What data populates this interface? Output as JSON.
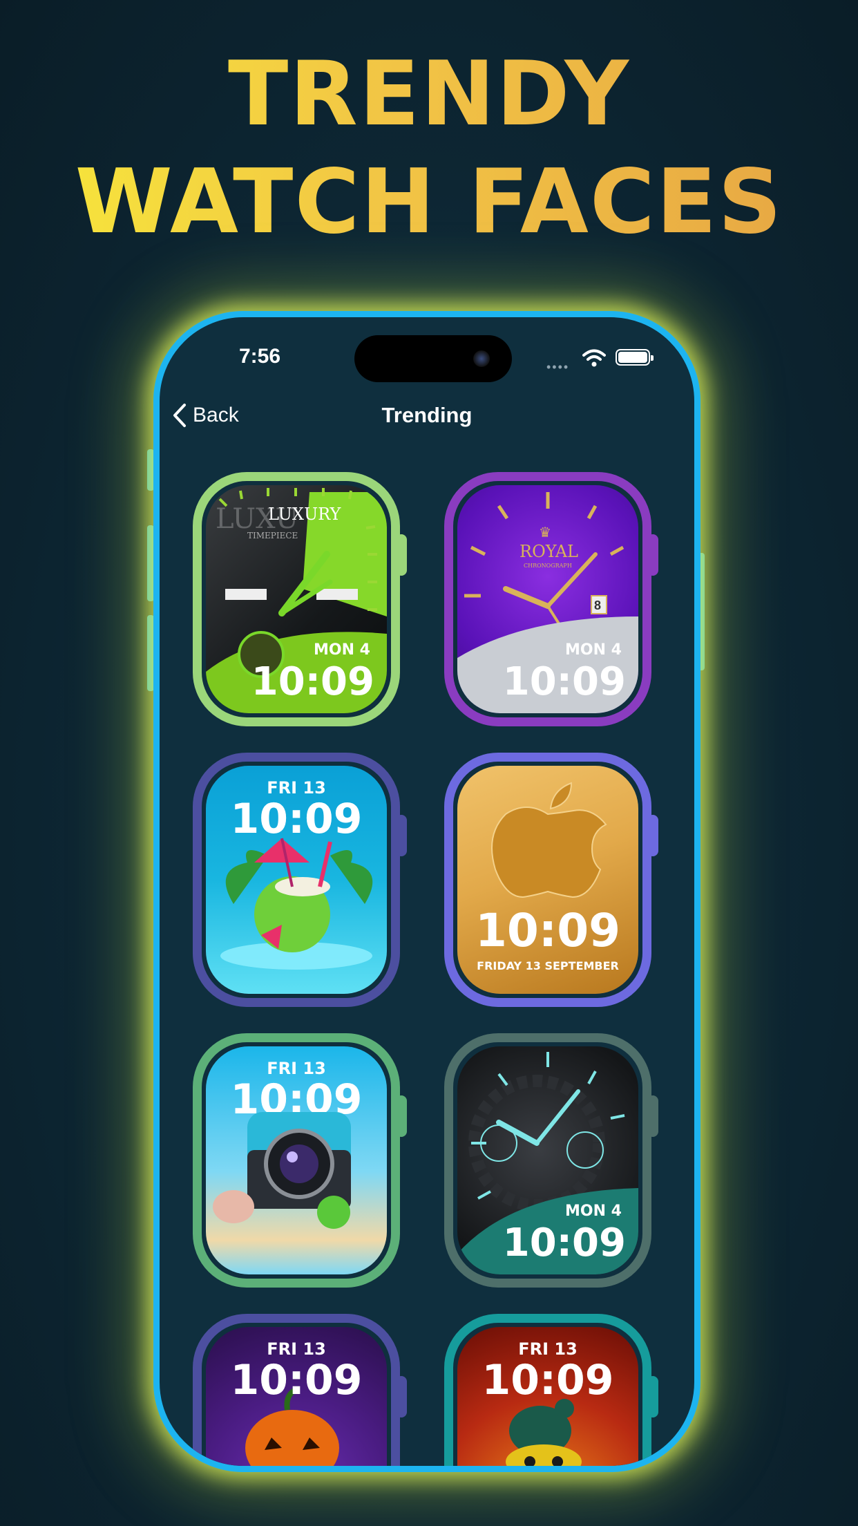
{
  "headline": {
    "line1": "TRENDY",
    "line2": "WATCH FACES"
  },
  "status_bar": {
    "time": "7:56",
    "signal": "••••"
  },
  "nav": {
    "back_label": "Back",
    "title": "Trending"
  },
  "watches": [
    {
      "name": "luxury",
      "brand": "LUXURY",
      "brand_sub": "TIMEPIECE",
      "brand_ghost": "LUXU",
      "date": "MON 4",
      "time": "10:09",
      "bezel": "#9bd67a",
      "colors": [
        "#1c1f22",
        "#86d82a"
      ]
    },
    {
      "name": "royal",
      "brand": "ROYAL",
      "brand_sub": "CHRONOGRAPH",
      "day_box": "8",
      "date": "MON 4",
      "time": "10:09",
      "bezel": "#8a3cc0",
      "colors": [
        "#5a12b8",
        "#c9cdd3"
      ]
    },
    {
      "name": "coconut",
      "date": "FRI 13",
      "time": "10:09",
      "bezel": "#4c4fa0",
      "colors": [
        "#19b6e0",
        "#4fdcf2"
      ]
    },
    {
      "name": "gold-apple",
      "date": "FRIDAY 13 SEPTEMBER",
      "time": "10:09",
      "bezel": "#6d6ae0",
      "colors": [
        "#e2a94a",
        "#b8781e"
      ]
    },
    {
      "name": "camera-beach",
      "date": "FRI 13",
      "time": "10:09",
      "bezel": "#5cb078",
      "colors": [
        "#2ec2ec",
        "#f0d9a8"
      ]
    },
    {
      "name": "mechanical",
      "date": "MON 4",
      "time": "10:09",
      "bezel": "#4e6f6a",
      "colors": [
        "#141618",
        "#1c7c72"
      ]
    },
    {
      "name": "halloween",
      "date": "FRI 13",
      "time": "10:09",
      "bezel": "#4c4fa0",
      "colors": [
        "#4a1c82",
        "#2a0f4c"
      ]
    },
    {
      "name": "fire-bomb",
      "date": "FRI 13",
      "time": "10:09",
      "bezel": "#169c9c",
      "colors": [
        "#b82a12",
        "#f08a1a"
      ]
    }
  ]
}
